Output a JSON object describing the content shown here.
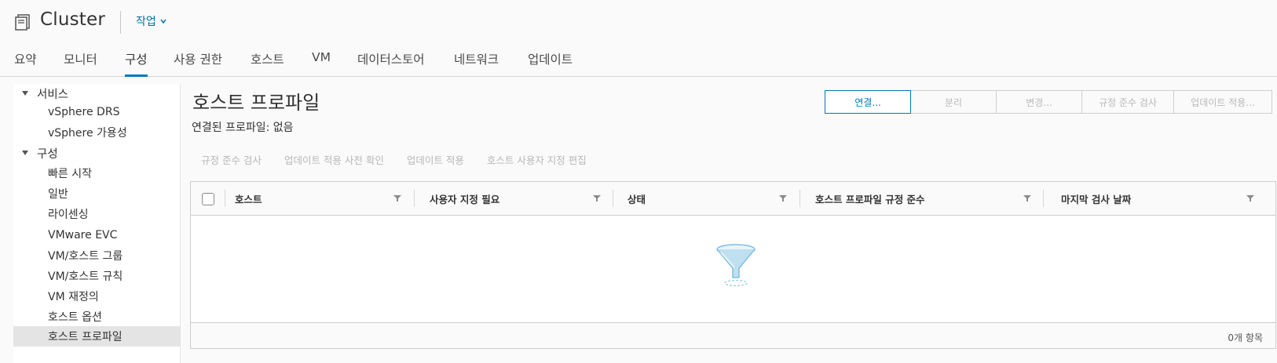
{
  "header": {
    "title": "Cluster",
    "actions_label": "작업",
    "icon": "cluster-icon"
  },
  "tabs": [
    {
      "label": "요약"
    },
    {
      "label": "모니터"
    },
    {
      "label": "구성",
      "active": true
    },
    {
      "label": "사용 권한"
    },
    {
      "label": "호스트"
    },
    {
      "label": "VM"
    },
    {
      "label": "데이터스토어"
    },
    {
      "label": "네트워크"
    },
    {
      "label": "업데이트"
    }
  ],
  "sidebar": {
    "groups": [
      {
        "label": "서비스",
        "expanded": true,
        "items": [
          {
            "label": "vSphere DRS"
          },
          {
            "label": "vSphere 가용성"
          }
        ]
      },
      {
        "label": "구성",
        "expanded": true,
        "items": [
          {
            "label": "빠른 시작"
          },
          {
            "label": "일반"
          },
          {
            "label": "라이센싱"
          },
          {
            "label": "VMware EVC"
          },
          {
            "label": "VM/호스트 그룹"
          },
          {
            "label": "VM/호스트 규칙"
          },
          {
            "label": "VM 재정의"
          },
          {
            "label": "호스트 옵션"
          },
          {
            "label": "호스트 프로파일",
            "selected": true
          }
        ]
      }
    ]
  },
  "main": {
    "title": "호스트 프로파일",
    "linked_profile": "연결된 프로파일: 없음",
    "buttons": [
      {
        "label": "연결...",
        "enabled": true
      },
      {
        "label": "분리",
        "enabled": false
      },
      {
        "label": "변경...",
        "enabled": false
      },
      {
        "label": "규정 준수 검사",
        "enabled": false
      },
      {
        "label": "업데이트 적용...",
        "enabled": false
      }
    ],
    "subactions": [
      {
        "label": "규정 준수 검사"
      },
      {
        "label": "업데이트 적용 사전 확인"
      },
      {
        "label": "업데이트 적용"
      },
      {
        "label": "호스트 사용자 지정 편집"
      }
    ],
    "grid": {
      "columns": [
        {
          "label": "호스트"
        },
        {
          "label": "사용자 지정 필요"
        },
        {
          "label": "상태"
        },
        {
          "label": "호스트 프로파일 규정 준수"
        },
        {
          "label": "마지막 검사 날짜"
        }
      ],
      "rows": [],
      "footer_count": "0개 항목",
      "empty_icon": "funnel-empty-icon"
    }
  },
  "colors": {
    "accent": "#0079b8",
    "link": "#0072a3",
    "disabled_text": "#b8b8b8",
    "selected_row": "#e4e4e4"
  }
}
